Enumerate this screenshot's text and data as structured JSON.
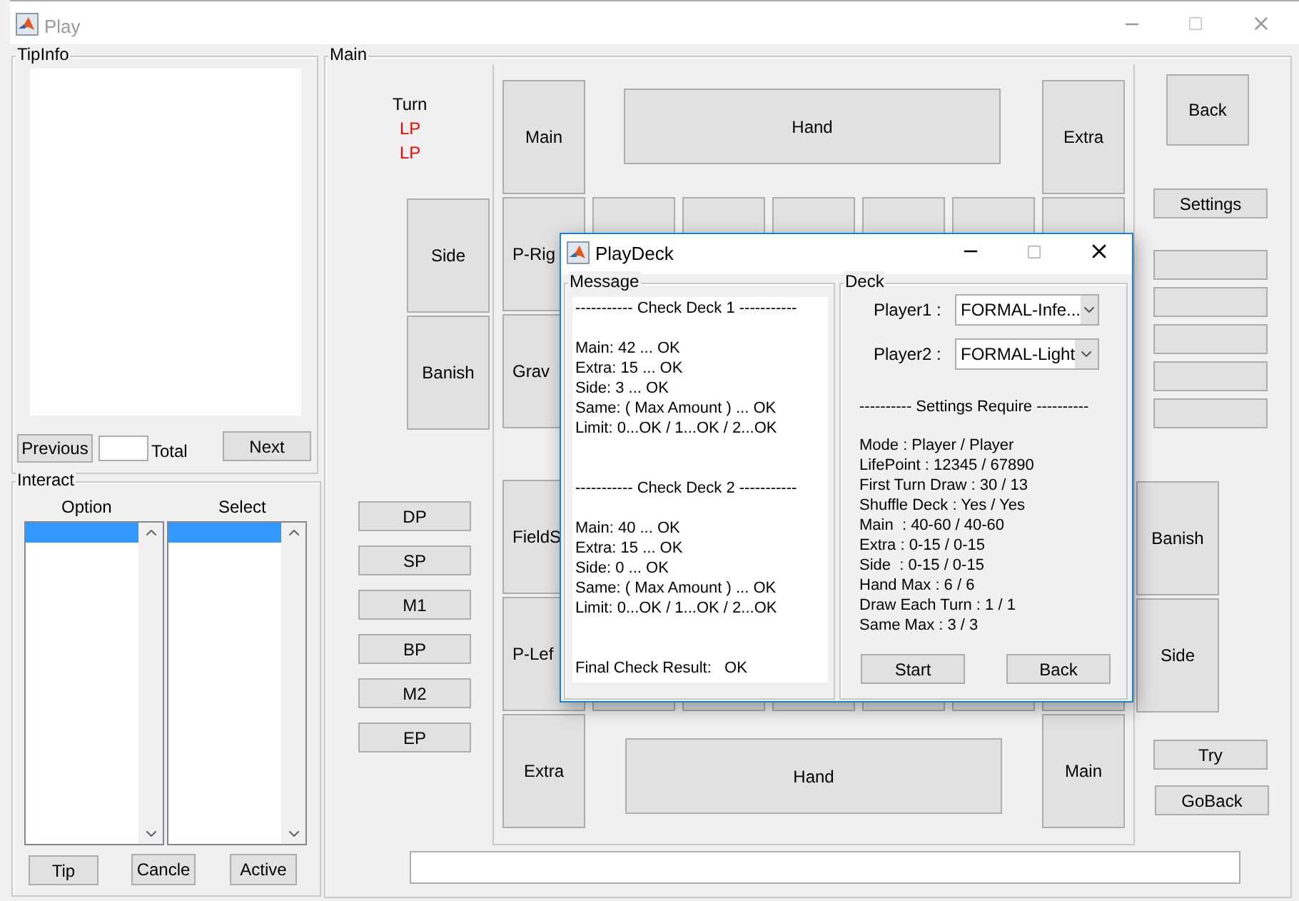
{
  "window": {
    "title": "Play"
  },
  "tipinfo": {
    "title": "TipInfo",
    "previous": "Previous",
    "total": "Total",
    "next": "Next"
  },
  "interact": {
    "title": "Interact",
    "option_header": "Option",
    "select_header": "Select",
    "option_list": {
      "first_row_selected": true
    },
    "select_list": {
      "first_row_selected": true
    },
    "buttons": [
      "Tip",
      "Cancle",
      "Active"
    ]
  },
  "main": {
    "title": "Main",
    "turn": "Turn",
    "lp": [
      "LP",
      "LP"
    ],
    "side_zone": [
      "Side",
      "Banish"
    ],
    "cells": [
      "Main",
      "Hand",
      "Extra",
      "P-Rig",
      "Grav",
      "FieldS",
      "P-Lef",
      "Extra",
      "Hand",
      "Main"
    ],
    "phases": [
      "DP",
      "SP",
      "M1",
      "BP",
      "M2",
      "EP"
    ],
    "right": {
      "back": "Back",
      "settings": "Settings",
      "banish": "Banish",
      "side": "Side",
      "try": "Try",
      "goback": "GoBack"
    }
  },
  "dialog": {
    "title": "PlayDeck",
    "message": {
      "title": "Message",
      "blocks": [
        {
          "kind": "header",
          "text": "----------- Check Deck 1 -----------"
        },
        {
          "kind": "lines",
          "lines": [
            "Main: 42 ... OK",
            "Extra: 15 ... OK",
            "Side: 3 ... OK",
            "Same: ( Max Amount ) ... OK",
            "Limit: 0...OK / 1...OK / 2...OK"
          ]
        },
        {
          "kind": "header",
          "text": "----------- Check Deck 2 -----------"
        },
        {
          "kind": "lines",
          "lines": [
            "Main: 40 ... OK",
            "Extra: 15 ... OK",
            "Side: 0 ... OK",
            "Same: ( Max Amount ) ... OK",
            "Limit: 0...OK / 1...OK / 2...OK"
          ]
        },
        {
          "kind": "result",
          "text": "Final Check Result:   OK"
        }
      ]
    },
    "deck": {
      "title": "Deck",
      "players": [
        {
          "label": "Player1 :",
          "value": "FORMAL-Infe..."
        },
        {
          "label": "Player2 :",
          "value": "FORMAL-Light"
        }
      ],
      "settings_header": "---------- Settings Require ----------",
      "settings": [
        "Mode : Player / Player",
        "LifePoint : 12345 / 67890",
        "First Turn Draw : 30 / 13",
        "Shuffle Deck : Yes / Yes",
        "Main  : 40-60 / 40-60",
        "Extra : 0-15 / 0-15",
        "Side  : 0-15 / 0-15",
        "Hand Max : 6 / 6",
        "Draw Each Turn : 1 / 1",
        "Same Max : 3 / 3"
      ],
      "buttons": [
        "Start",
        "Back"
      ]
    }
  }
}
